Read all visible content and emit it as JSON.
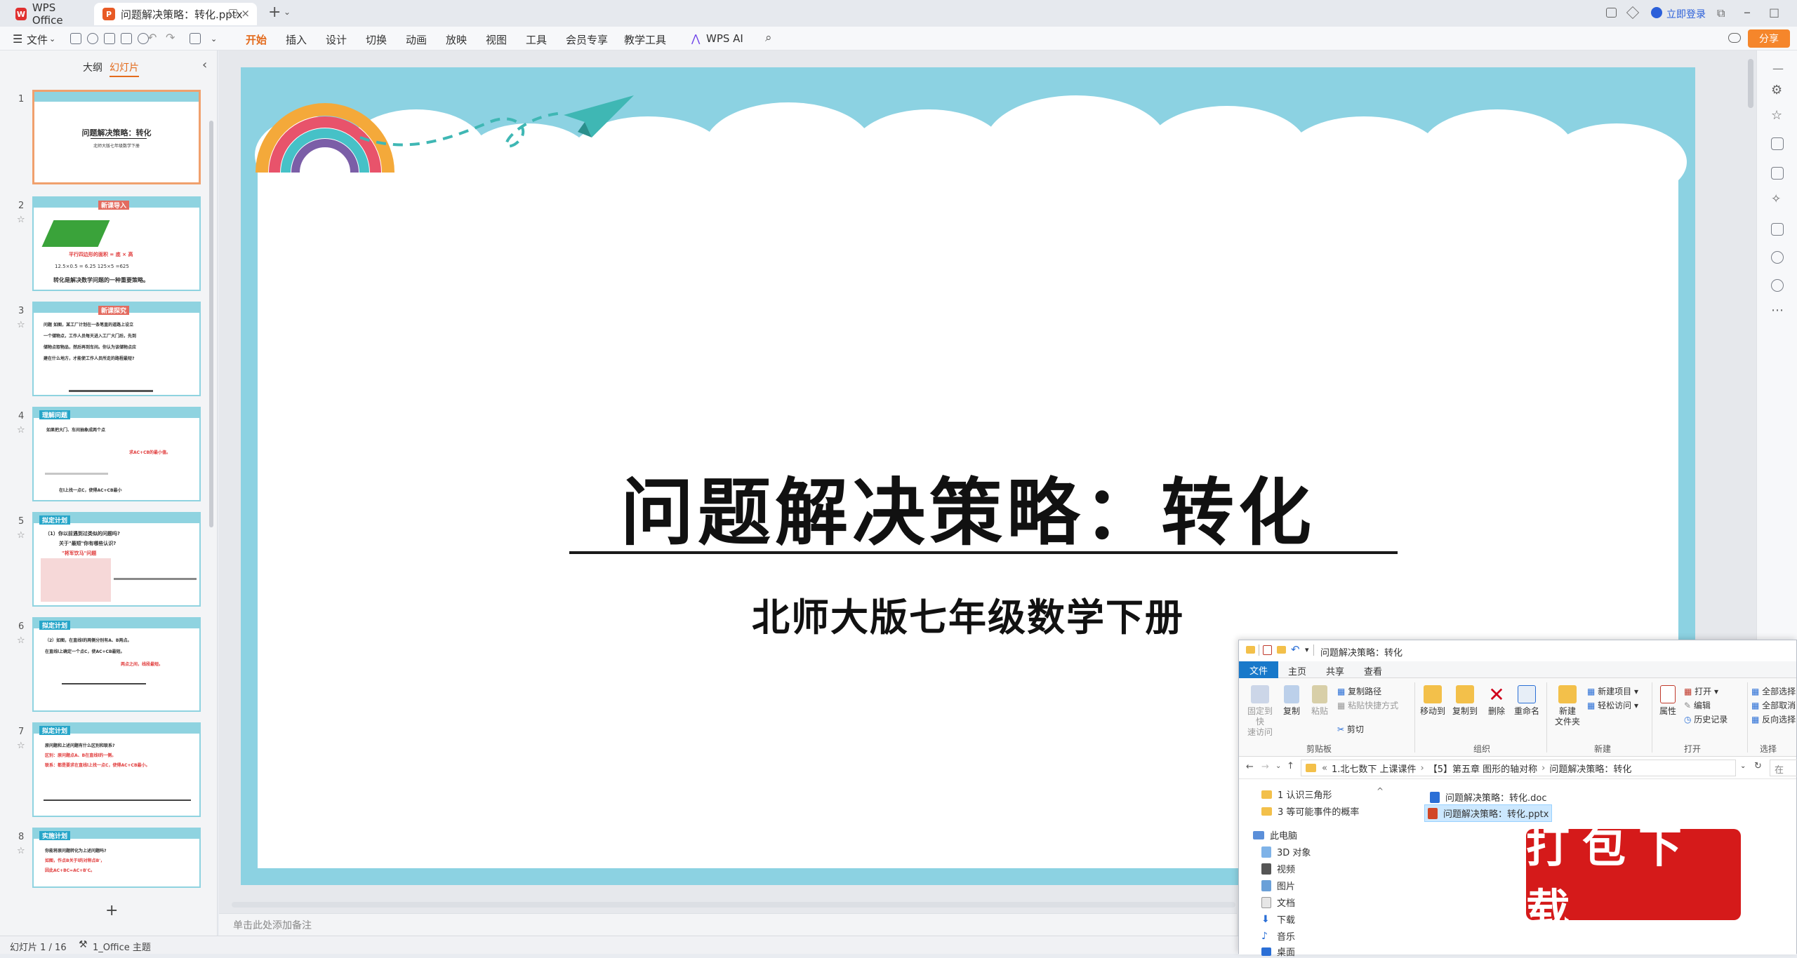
{
  "titlebar": {
    "app_tab": "WPS Office",
    "doc_tab": "问题解决策略：转化.pptx",
    "login": "立即登录"
  },
  "menubar": {
    "file": "文件",
    "items": [
      "开始",
      "插入",
      "设计",
      "切换",
      "动画",
      "放映",
      "视图",
      "工具",
      "会员专享",
      "教学工具"
    ],
    "ai": "WPS AI",
    "share": "分享"
  },
  "leftpanel": {
    "tab_outline": "大纲",
    "tab_slides": "幻灯片",
    "slides": [
      {
        "num": "1",
        "title": "问题解决策略：转化",
        "sub": "北师大版七年级数学下册"
      },
      {
        "num": "2",
        "label": "新课导入",
        "line1": "平行四边形的面积 = 底 × 高",
        "line2": "12.5×0.5 = 6.25    125×5 =625",
        "line3": "转化是解决数学问题的一种重要策略。"
      },
      {
        "num": "3",
        "label": "新课探究",
        "line1": "问题  如图，某工厂计划在一条笔直的道路上设立",
        "line2": "一个储物点，工作人员每天进入工厂大门后，先到",
        "line3": "储物点取物品，然后再到车间。你认为该储物点应",
        "line4": "建在什么地方，才能使工作人员所走的路程最短?"
      },
      {
        "num": "4",
        "label": "理解问题",
        "line1": "如果把大门、车间抽象成两个点",
        "line2": "求AC+CB的最小值。",
        "line3": "在l上找一点C，使得AC+CB最小"
      },
      {
        "num": "5",
        "label": "拟定计划",
        "line1": "（1）你以前遇到过类似的问题吗?",
        "line2": "关于\"最短\"你有哪些认识?",
        "line3": "\"将军饮马\"问题"
      },
      {
        "num": "6",
        "label": "拟定计划",
        "line1": "（2）如图，在直线l的两侧分别有A、B两点。",
        "line2": "在直线l上确定一个点C，使AC+CB最短。",
        "line3": "两点之间，线段最短。"
      },
      {
        "num": "7",
        "label": "拟定计划",
        "line1": "原问题和上述问题有什么区别和联系?",
        "line2": "区别：原问题点A、B在直线l的一侧。",
        "line3": "联系：都是要求在直线l上找一点C，使得AC+CB最小。"
      },
      {
        "num": "8",
        "label": "实施计划",
        "line1": "你能将原问题转化为上述问题吗?",
        "line2": "如图，作点B关于l的对称点B'，",
        "line3": "因此AC+BC=AC+B'C。"
      }
    ],
    "add_label": "+"
  },
  "slide": {
    "title": "问题解决策略：转化",
    "subtitle": "北师大版七年级数学下册"
  },
  "notes": {
    "placeholder": "单击此处添加备注"
  },
  "statusbar": {
    "slide_count": "幻灯片 1 / 16",
    "theme": "1_Office 主题"
  },
  "explorer": {
    "title": "问题解决策略：转化",
    "tabs": [
      "文件",
      "主页",
      "共享",
      "查看"
    ],
    "ribbon": {
      "pin": "固定到快\n速访问",
      "copy": "复制",
      "paste": "粘贴",
      "copy_path": "复制路径",
      "paste_shortcut": "粘贴快捷方式",
      "cut": "剪切",
      "group_clipboard": "剪贴板",
      "move_to": "移动到",
      "copy_to": "复制到",
      "delete": "删除",
      "rename": "重命名",
      "group_organize": "组织",
      "new_folder": "新建\n文件夹",
      "new_item": "新建项目",
      "easy_access": "轻松访问",
      "group_new": "新建",
      "properties": "属性",
      "open": "打开",
      "edit": "编辑",
      "history": "历史记录",
      "group_open": "打开",
      "select_all": "全部选择",
      "select_none": "全部取消",
      "invert": "反向选择",
      "group_select": "选择"
    },
    "address": [
      "1.北七数下 上课课件",
      "【5】第五章 图形的轴对称",
      "问题解决策略：转化"
    ],
    "search_placeholder": "在",
    "nav": [
      {
        "label": "1 认识三角形",
        "type": "folder"
      },
      {
        "label": "3 等可能事件的概率",
        "type": "folder"
      },
      {
        "label": "此电脑",
        "type": "pc"
      },
      {
        "label": "3D 对象",
        "type": "3d"
      },
      {
        "label": "视频",
        "type": "video"
      },
      {
        "label": "图片",
        "type": "pic"
      },
      {
        "label": "文档",
        "type": "doc"
      },
      {
        "label": "下载",
        "type": "dl"
      },
      {
        "label": "音乐",
        "type": "music"
      },
      {
        "label": "桌面",
        "type": "desk"
      }
    ],
    "files": [
      {
        "name": "问题解决策略：转化.doc",
        "color": "#2b6fd6"
      },
      {
        "name": "问题解决策略：转化.pptx",
        "color": "#d24726"
      }
    ]
  },
  "stamp": {
    "text": "打包下载"
  }
}
